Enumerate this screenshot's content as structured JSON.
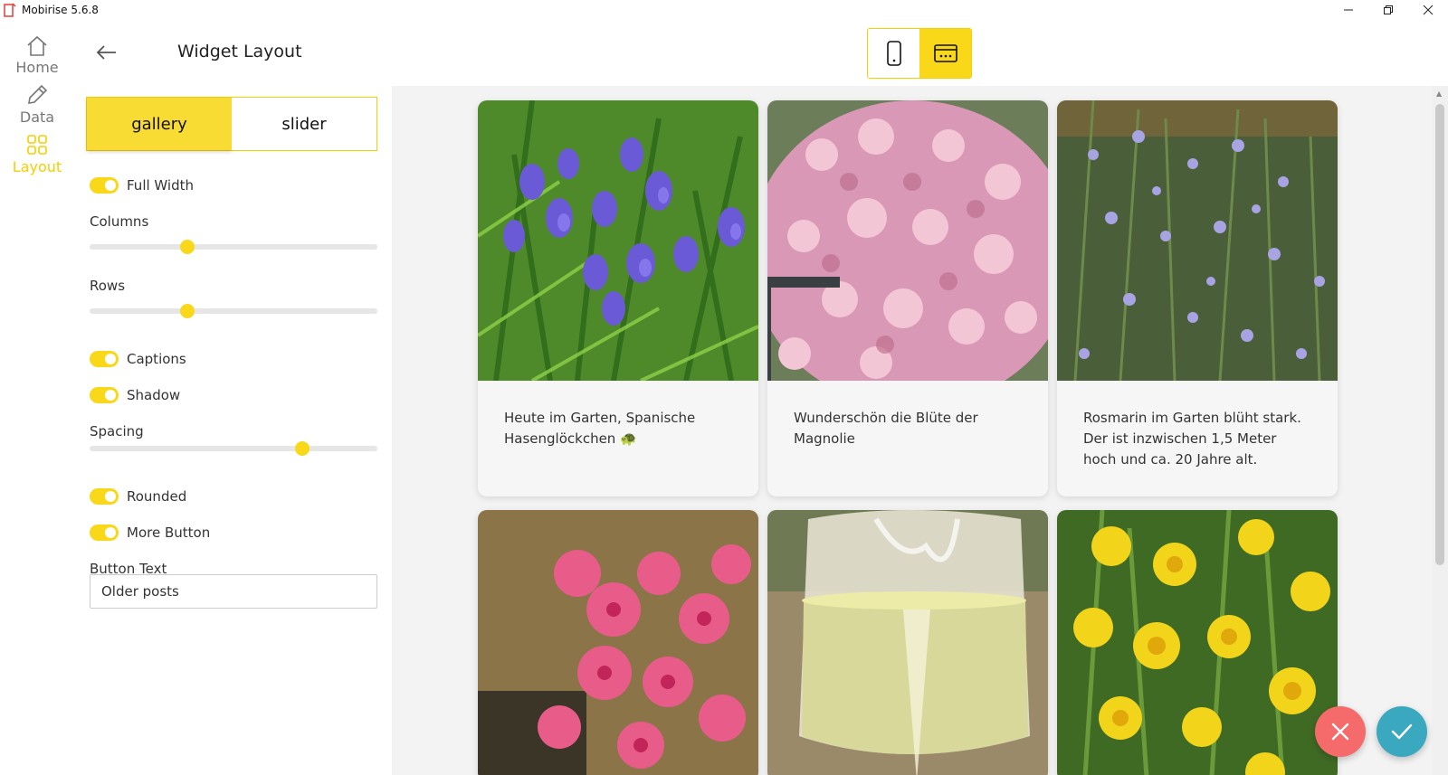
{
  "window": {
    "title": "Mobirise 5.6.8",
    "controls": [
      "minimize-icon",
      "restore-icon",
      "close-icon"
    ]
  },
  "rail": {
    "items": [
      {
        "label": "Home",
        "icon": "home-icon"
      },
      {
        "label": "Data",
        "icon": "pencil-icon"
      },
      {
        "label": "Layout",
        "icon": "grid-icon",
        "active": true
      }
    ]
  },
  "header": {
    "title": "Widget Layout",
    "back_icon": "arrow-left-icon"
  },
  "device_switch": [
    {
      "icon": "mobile-icon",
      "active": false
    },
    {
      "icon": "desktop-icon",
      "active": true
    }
  ],
  "panel": {
    "tabs": [
      {
        "label": "gallery",
        "active": true
      },
      {
        "label": "slider",
        "active": false
      }
    ],
    "full_width": {
      "label": "Full Width",
      "on": true
    },
    "columns": {
      "label": "Columns",
      "value": 0.34
    },
    "rows": {
      "label": "Rows",
      "value": 0.34
    },
    "captions": {
      "label": "Captions",
      "on": true
    },
    "shadow": {
      "label": "Shadow",
      "on": true
    },
    "spacing": {
      "label": "Spacing",
      "value": 0.74
    },
    "rounded": {
      "label": "Rounded",
      "on": true
    },
    "more_button": {
      "label": "More Button",
      "on": true
    },
    "button_text": {
      "label": "Button Text",
      "value": "Older posts"
    }
  },
  "gallery": [
    {
      "caption": "Heute im Garten, Spanische Hasenglöckchen 🐢",
      "photo": "bluebells"
    },
    {
      "caption": "Wunderschön die Blüte der Magnolie",
      "photo": "magnolia"
    },
    {
      "caption": "Rosmarin im Garten blüht stark. Der ist inzwischen 1,5 Meter hoch und ca. 20 Jahre alt.",
      "photo": "rosemary"
    },
    {
      "caption": "",
      "photo": "peach-blossom"
    },
    {
      "caption": "",
      "photo": "wine-glass"
    },
    {
      "caption": "",
      "photo": "daffodils"
    }
  ],
  "colors": {
    "accent": "#f9d81a",
    "cancel": "#f56a6a",
    "confirm": "#3aa9c0"
  },
  "fabs": {
    "cancel_icon": "close-icon",
    "confirm_icon": "check-icon"
  }
}
